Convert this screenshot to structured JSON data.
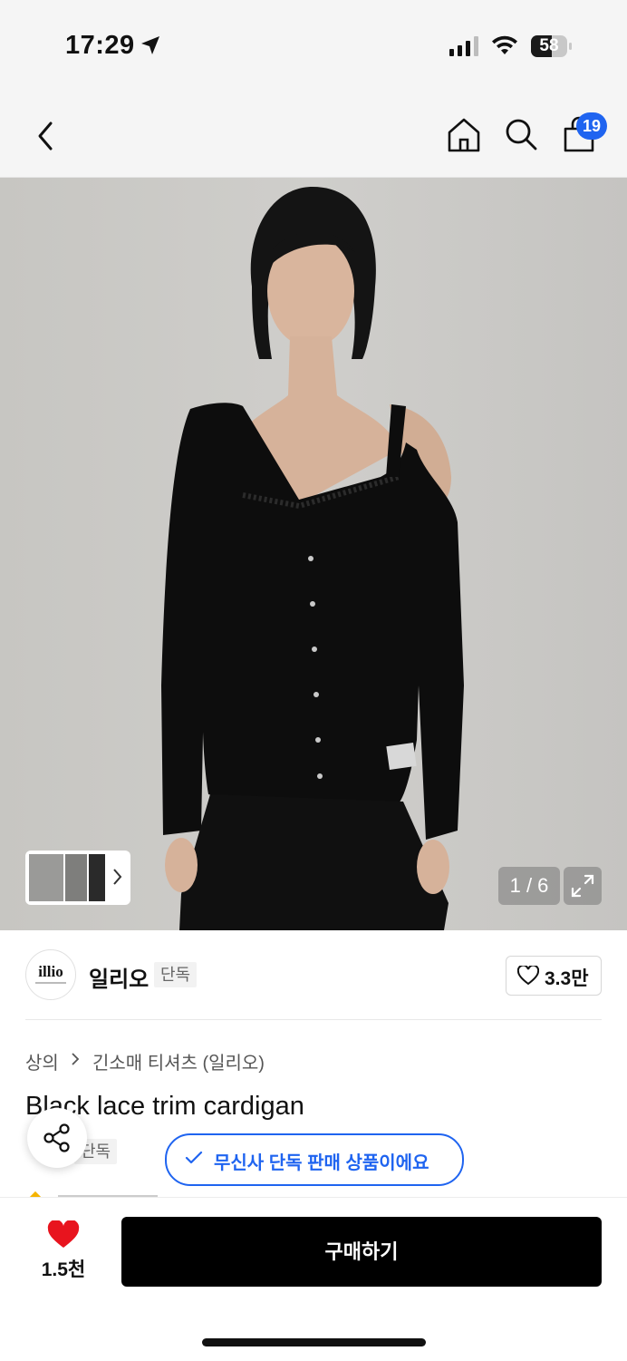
{
  "status": {
    "time": "17:29",
    "battery": "58",
    "battery_level": 0.58
  },
  "nav": {
    "cart_count": "19"
  },
  "gallery": {
    "page": "1 / 6",
    "current_index": 1,
    "total": 6
  },
  "brand": {
    "logo_text": "illio",
    "name": "일리오",
    "exclusive_tag": "단독",
    "likes": "3.3만"
  },
  "breadcrumb": {
    "category": "상의",
    "subcategory": "긴소매 티셔츠 (일리오)"
  },
  "product": {
    "title": "Black lace trim cardigan",
    "exclusive_tag": "단독"
  },
  "notice": {
    "exclusive_text": "무신사 단독 판매 상품이에요"
  },
  "bottom": {
    "wish_count": "1.5천",
    "buy_label": "구매하기"
  },
  "colors": {
    "accent": "#1f64f0",
    "heart": "#e8141e",
    "buy": "#000000"
  }
}
